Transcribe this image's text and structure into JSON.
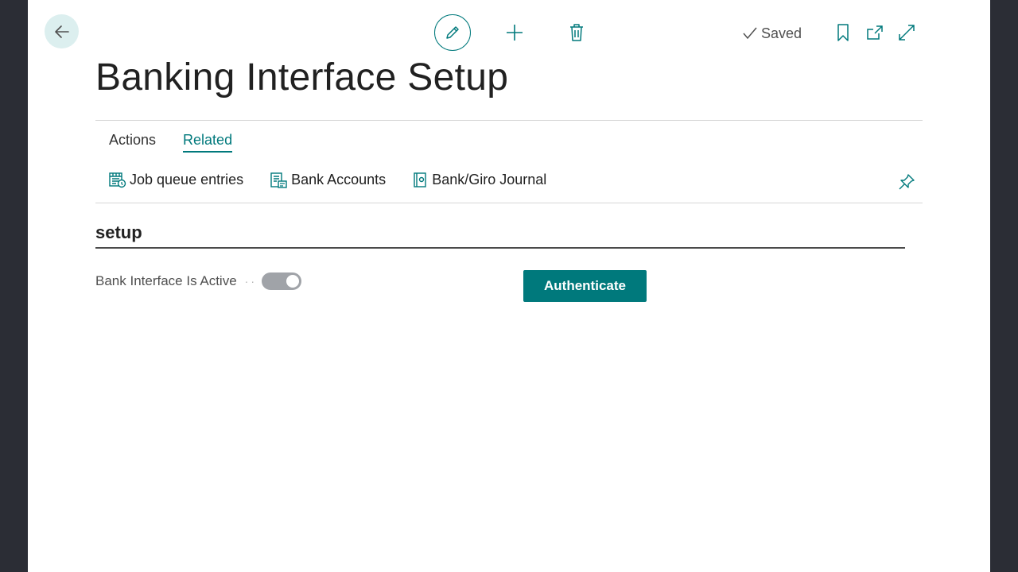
{
  "header": {
    "title": "Banking Interface Setup",
    "status": "Saved"
  },
  "tabs": [
    {
      "label": "Actions",
      "active": false
    },
    {
      "label": "Related",
      "active": true
    }
  ],
  "related_actions": [
    {
      "label": "Job queue entries",
      "icon": "job-queue-icon"
    },
    {
      "label": "Bank Accounts",
      "icon": "bank-accounts-icon"
    },
    {
      "label": "Bank/Giro Journal",
      "icon": "journal-icon"
    }
  ],
  "section": {
    "title": "setup",
    "field_label": "Bank Interface Is Active",
    "toggle_on": true,
    "authenticate_label": "Authenticate"
  },
  "colors": {
    "accent": "#00797c",
    "background": "#2b2d35",
    "back_button_bg": "#dcefef"
  }
}
